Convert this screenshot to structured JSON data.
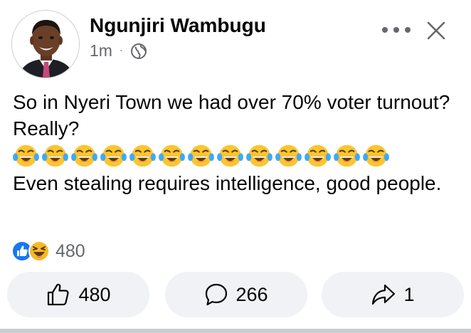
{
  "post": {
    "author": "Ngunjiri Wambugu",
    "time": "1m",
    "separator": "·",
    "audience_icon": "globe-icon",
    "text_line1": "So in Nyeri Town we had over 70% voter turnout? Really?",
    "laugh_emoji_count": 13,
    "text_line2": "Even stealing requires intelligence, good people."
  },
  "reactions": {
    "icons": [
      "like-icon",
      "haha-icon"
    ],
    "count": "480"
  },
  "actions": {
    "like_count": "480",
    "comment_count": "266",
    "share_count": "1"
  },
  "colors": {
    "like_blue": "#1877f2",
    "haha_yellow": "#f7b928",
    "secondary_text": "#65676b",
    "button_bg": "#f0f2f5"
  }
}
